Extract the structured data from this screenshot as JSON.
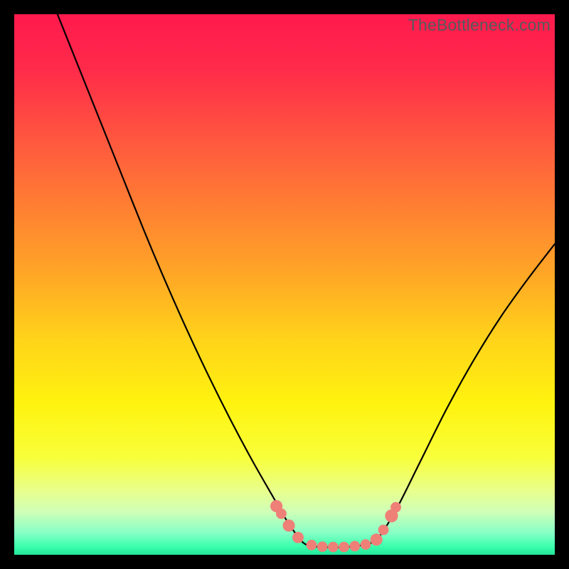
{
  "watermark": "TheBottleneck.com",
  "colors": {
    "gradient_stops": [
      {
        "offset": 0.0,
        "color": "#ff1a4d"
      },
      {
        "offset": 0.1,
        "color": "#ff2a4a"
      },
      {
        "offset": 0.22,
        "color": "#ff5340"
      },
      {
        "offset": 0.35,
        "color": "#ff7d33"
      },
      {
        "offset": 0.48,
        "color": "#ffa626"
      },
      {
        "offset": 0.6,
        "color": "#ffd31a"
      },
      {
        "offset": 0.72,
        "color": "#fff30f"
      },
      {
        "offset": 0.82,
        "color": "#f8ff3a"
      },
      {
        "offset": 0.88,
        "color": "#e9ff8a"
      },
      {
        "offset": 0.92,
        "color": "#d0ffb8"
      },
      {
        "offset": 0.96,
        "color": "#86ffc6"
      },
      {
        "offset": 0.985,
        "color": "#3affac"
      },
      {
        "offset": 1.0,
        "color": "#22e59b"
      }
    ],
    "curve_color": "#000000",
    "marker_color": "#ee8078",
    "bg": "#000000"
  },
  "chart_data": {
    "type": "line",
    "title": "",
    "xlabel": "",
    "ylabel": "",
    "xlim": [
      0,
      100
    ],
    "ylim": [
      0,
      100
    ],
    "series": [
      {
        "name": "left-curve",
        "x": [
          8,
          12,
          16,
          20,
          24,
          28,
          32,
          36,
          40,
          44,
          48,
          50,
          52,
          53.5
        ],
        "y": [
          100,
          90,
          80,
          70,
          60,
          50.5,
          41.5,
          33,
          25,
          17.5,
          10.5,
          7,
          4,
          2.2
        ]
      },
      {
        "name": "floor-curve",
        "x": [
          53.5,
          55,
          58,
          61,
          64,
          66.5
        ],
        "y": [
          2.2,
          1.6,
          1.4,
          1.4,
          1.7,
          2.4
        ]
      },
      {
        "name": "right-curve",
        "x": [
          66.5,
          68,
          71,
          75,
          80,
          85,
          90,
          95,
          100
        ],
        "y": [
          2.4,
          4,
          9,
          17,
          27,
          36,
          44,
          51,
          57.5
        ]
      }
    ],
    "markers": [
      {
        "x": 48.5,
        "y": 9.0,
        "r": 1.5
      },
      {
        "x": 49.4,
        "y": 7.6,
        "r": 1.3
      },
      {
        "x": 50.8,
        "y": 5.4,
        "r": 1.5
      },
      {
        "x": 52.5,
        "y": 3.2,
        "r": 1.4
      },
      {
        "x": 55.0,
        "y": 1.8,
        "r": 1.3
      },
      {
        "x": 57.0,
        "y": 1.5,
        "r": 1.3
      },
      {
        "x": 59.0,
        "y": 1.45,
        "r": 1.3
      },
      {
        "x": 61.0,
        "y": 1.45,
        "r": 1.3
      },
      {
        "x": 63.0,
        "y": 1.6,
        "r": 1.3
      },
      {
        "x": 65.0,
        "y": 1.9,
        "r": 1.3
      },
      {
        "x": 67.0,
        "y": 2.8,
        "r": 1.5
      },
      {
        "x": 68.3,
        "y": 4.6,
        "r": 1.3
      },
      {
        "x": 69.8,
        "y": 7.2,
        "r": 1.6
      },
      {
        "x": 70.6,
        "y": 8.8,
        "r": 1.3
      }
    ]
  }
}
